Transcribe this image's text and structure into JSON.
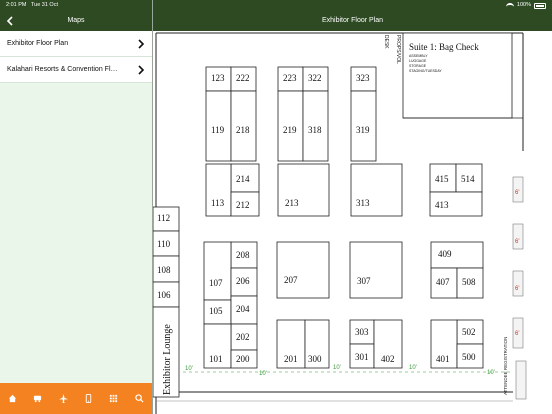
{
  "status": {
    "time": "2:01 PM",
    "date": "Tue 31 Oct",
    "battery": "100%"
  },
  "left_nav": {
    "title": "Maps"
  },
  "right_nav": {
    "title": "Exhibitor Floor Plan"
  },
  "sidebar": {
    "items": [
      {
        "label": "Exhibitor Floor Plan"
      },
      {
        "label": "Kalahari Resorts & Convention Fl…"
      }
    ]
  },
  "tabbar": {
    "icons": [
      "home-icon",
      "bus-icon",
      "plane-icon",
      "phone-icon",
      "grid-icon",
      "search-icon"
    ],
    "accent": "#f58220"
  },
  "colors": {
    "nav": "#2d4a22",
    "sidebar_bg": "#eaf6ea",
    "accent": "#f58220",
    "dimension_green": "#3a9a3a"
  },
  "floorplan": {
    "suite_title": "Suite 1: Bag Check",
    "suite_lines": [
      "ASSEMBLY",
      "LUGGAGE",
      "STORAGE",
      "STAGING/TUESDAY"
    ],
    "vertical_labels": [
      "DESK",
      "PROPS/VOL"
    ],
    "lounge": "Exhibitor Lounge",
    "side_booths": [
      "112",
      "110",
      "108",
      "106"
    ],
    "booths": [
      "123",
      "222",
      "119",
      "218",
      "223",
      "322",
      "219",
      "318",
      "323",
      "319",
      "214",
      "113",
      "212",
      "213",
      "313",
      "415",
      "514",
      "413",
      "208",
      "107",
      "206",
      "105",
      "204",
      "207",
      "307",
      "409",
      "407",
      "508",
      "202",
      "101",
      "200",
      "201",
      "300",
      "303",
      "301",
      "402",
      "502",
      "401",
      "500"
    ],
    "dimensions": {
      "ten": "10'",
      "six": "6'"
    },
    "bottom_label": "ATTENDEE REGISTRATION"
  }
}
